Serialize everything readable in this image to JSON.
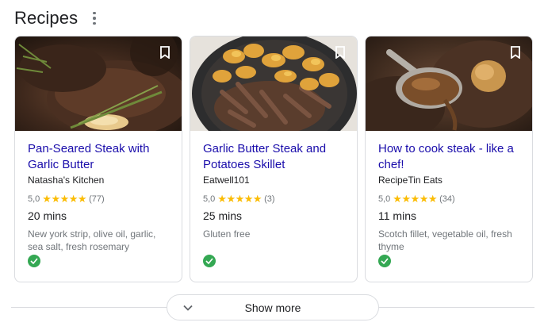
{
  "section": {
    "title": "Recipes"
  },
  "colors": {
    "link": "#1a0dab",
    "star": "#fbbc04",
    "check": "#34a853",
    "border": "#dadce0"
  },
  "cards": [
    {
      "title": "Pan-Seared Steak with Garlic Butter",
      "source": "Natasha's Kitchen",
      "rating": "5,0",
      "stars": "★★★★★",
      "reviews": "(77)",
      "time": "20 mins",
      "ingredients": "New york strip, olive oil, garlic, sea salt, fresh rosemary",
      "image_icon": "steak-photo"
    },
    {
      "title": "Garlic Butter Steak and Potatoes Skillet",
      "source": "Eatwell101",
      "rating": "5,0",
      "stars": "★★★★★",
      "reviews": "(3)",
      "time": "25 mins",
      "ingredients": "Gluten free",
      "image_icon": "skillet-photo"
    },
    {
      "title": "How to cook steak - like a chef!",
      "source": "RecipeTin Eats",
      "rating": "5,0",
      "stars": "★★★★★",
      "reviews": "(34)",
      "time": "11 mins",
      "ingredients": "Scotch fillet, vegetable oil, fresh thyme",
      "image_icon": "steak-sauce-photo"
    }
  ],
  "show_more": {
    "label": "Show more"
  }
}
